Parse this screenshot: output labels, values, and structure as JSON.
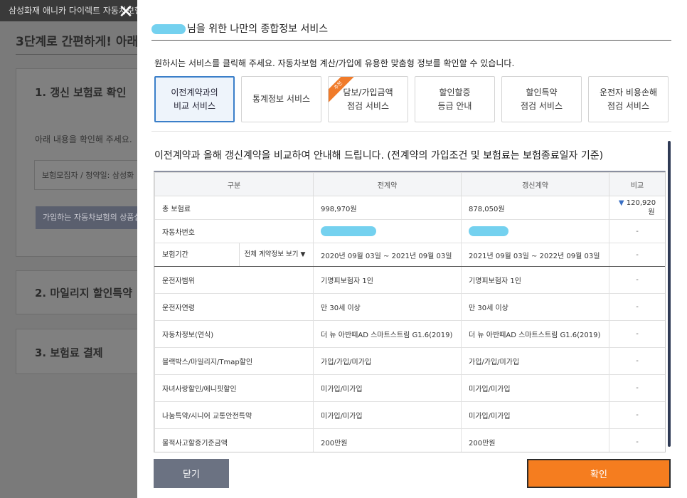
{
  "background": {
    "topbar_text": "삼성화재 애니카 다이렉트 자동차보험",
    "heading": "3단계로 간편하게! 아래",
    "step1_title": "1. 갱신 보험료 확인",
    "step1_instruction": "아래 내용을 확인해 주세요.",
    "step1_info": "보험모집자 / 청약일: 삼성화",
    "step1_button": "가입하는 자동차보험의 상품설",
    "step2_title": "2. 마일리지 할인특약",
    "step3_title": "3. 보험료 결제"
  },
  "modal": {
    "title_suffix": "님을 위한 나만의 종합정보 서비스",
    "guide_text": "원하시는 서비스를 클릭해 주세요. 자동차보험 계산/가입에 유용한 맞춤형 정보를 확인할 수 있습니다.",
    "services": [
      {
        "label": "이전계약과의\n비교 서비스",
        "active": true
      },
      {
        "label": "통계정보 서비스"
      },
      {
        "label": "담보/가입금액\n점검 서비스",
        "badge": "추천"
      },
      {
        "label": "할인할증\n등급 안내"
      },
      {
        "label": "할인특약\n점검 서비스"
      },
      {
        "label": "운전자 비용손해\n점검 서비스"
      }
    ],
    "section_title": "이전계약과 올해 갱신계약을 비교하여 안내해 드립니다. (전계약의 가입조건 및 보험료는 보험종료일자 기준)",
    "table": {
      "headers": [
        "구분",
        "전계약",
        "갱신계약",
        "비교"
      ],
      "period_select": "전체 계약정보 보기",
      "rows": [
        {
          "label": "총 보험료",
          "prev": "998,970원",
          "renew": "878,050원",
          "compare_arrow": "▼",
          "compare": "120,920",
          "compare_unit": "원"
        },
        {
          "label": "자동차번호",
          "prev": "",
          "renew": "",
          "compare": "-"
        },
        {
          "label": "보험기간",
          "prev": "2020년 09월 03일 ~ 2021년 09월 03일",
          "renew": "2021년 09월 03일 ~ 2022년 09월 03일",
          "compare": "-"
        },
        {
          "label": "운전자범위",
          "prev": "기명피보험자 1인",
          "renew": "기명피보험자 1인",
          "compare": "-"
        },
        {
          "label": "운전자연령",
          "prev": "만 30세 이상",
          "renew": "만 30세 이상",
          "compare": "-"
        },
        {
          "label": "자동차정보(연식)",
          "prev": "더 뉴 아반떼AD 스마트스트림 G1.6(2019)",
          "renew": "더 뉴 아반떼AD 스마트스트림 G1.6(2019)",
          "compare": "-"
        },
        {
          "label": "블랙박스/마일리지/Tmap할인",
          "prev": "가입/가입/미가입",
          "renew": "가입/가입/미가입",
          "compare": "-"
        },
        {
          "label": "자녀사랑할인/에니핏할인",
          "prev": "미가입/미가입",
          "renew": "미가입/미가입",
          "compare": "-"
        },
        {
          "label": "나눔특약/시니어 교통안전특약",
          "prev": "미가입/미가입",
          "renew": "미가입/미가입",
          "compare": "-"
        },
        {
          "label": "물적사고할증기준금액",
          "prev": "200만원",
          "renew": "200만원",
          "compare": "-"
        }
      ]
    },
    "close_button": "닫기",
    "confirm_button": "확인"
  },
  "colors": {
    "accent_orange": "#f57d1f",
    "active_blue": "#3b7fc9",
    "redaction": "#74d1ef"
  }
}
